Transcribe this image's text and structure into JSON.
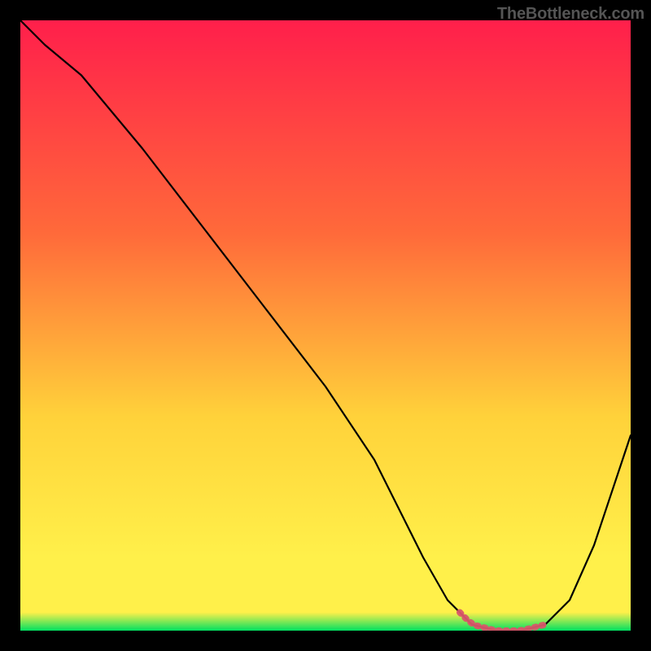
{
  "watermark": "TheBottleneck.com",
  "colors": {
    "bg": "#000000",
    "grad_top": "#ff1f4b",
    "grad_mid1": "#ff6a3a",
    "grad_mid2": "#ffd23a",
    "grad_low": "#fff04a",
    "grad_base": "#00e060",
    "curve": "#000000",
    "valley_highlight": "#d9566a"
  },
  "chart_data": {
    "type": "line",
    "title": "",
    "xlabel": "",
    "ylabel": "",
    "xlim": [
      0,
      100
    ],
    "ylim": [
      0,
      100
    ],
    "x": [
      0,
      4,
      10,
      20,
      30,
      40,
      50,
      58,
      62,
      66,
      70,
      74,
      78,
      82,
      86,
      90,
      94,
      100
    ],
    "values": [
      100,
      96,
      91,
      79,
      66,
      53,
      40,
      28,
      20,
      12,
      5,
      1,
      0,
      0,
      1,
      5,
      14,
      32
    ],
    "valley_region_x": [
      72,
      86
    ],
    "annotations": []
  }
}
